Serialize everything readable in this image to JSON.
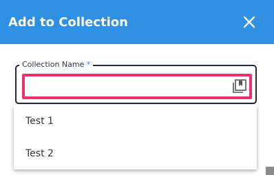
{
  "dialog": {
    "title": "Add to Collection",
    "close_icon": "close-icon"
  },
  "field": {
    "label": "Collection Name",
    "required_marker": "*",
    "value": "",
    "trailing_icon": "collection-bookmark-icon"
  },
  "dropdown": {
    "options": [
      {
        "label": "Test 1"
      },
      {
        "label": "Test 2"
      }
    ]
  },
  "colors": {
    "header_bg": "#2e8fe3",
    "highlight_border": "#f0306d",
    "field_border": "#1f2937",
    "required": "#1f7bd6"
  }
}
